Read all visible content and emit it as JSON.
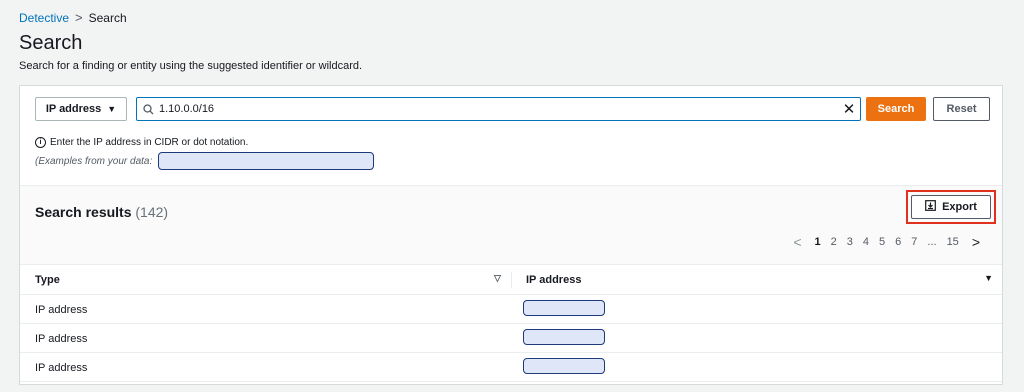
{
  "breadcrumb": {
    "parent": "Detective",
    "separator": ">",
    "current": "Search"
  },
  "page": {
    "title": "Search",
    "description": "Search for a finding or entity using the suggested identifier or wildcard."
  },
  "search": {
    "type_label": "IP address",
    "query": "1.10.0.0/16",
    "search_label": "Search",
    "reset_label": "Reset",
    "hint": "Enter the IP address in CIDR or dot notation.",
    "examples_label": "(Examples from your data:"
  },
  "results": {
    "title": "Search results",
    "count": "(142)",
    "export_label": "Export",
    "pagination": {
      "prev": "<",
      "pages": [
        "1",
        "2",
        "3",
        "4",
        "5",
        "6",
        "7",
        "...",
        "15"
      ],
      "current": "1",
      "next": ">"
    },
    "columns": {
      "type": "Type",
      "ip": "IP address"
    },
    "rows": [
      {
        "type": "IP address"
      },
      {
        "type": "IP address"
      },
      {
        "type": "IP address"
      }
    ]
  },
  "colors": {
    "accent": "#ec7211",
    "link": "#0073bb",
    "highlight": "#e0301e"
  }
}
